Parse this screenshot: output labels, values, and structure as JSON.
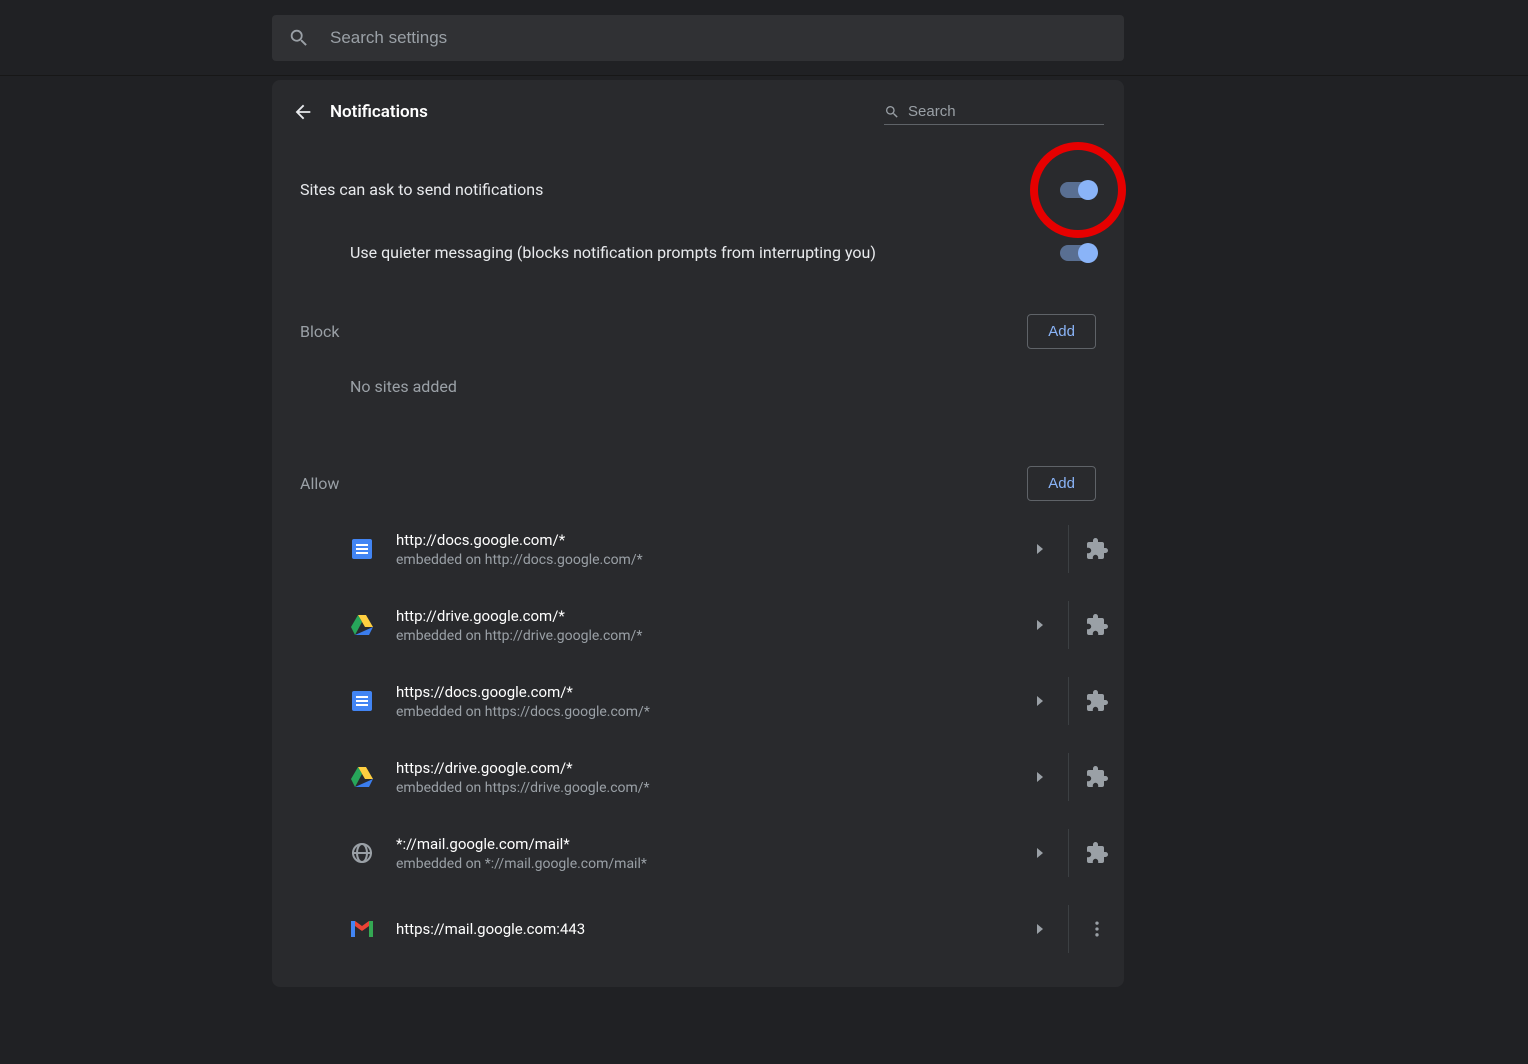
{
  "global_search": {
    "placeholder": "Search settings"
  },
  "page": {
    "title": "Notifications",
    "search_placeholder": "Search"
  },
  "toggles": {
    "ask": {
      "label": "Sites can ask to send notifications",
      "on": true,
      "highlighted": true
    },
    "quiet": {
      "label": "Use quieter messaging (blocks notification prompts from interrupting you)",
      "on": true
    }
  },
  "sections": {
    "block": {
      "label": "Block",
      "add": "Add",
      "empty": "No sites added"
    },
    "allow": {
      "label": "Allow",
      "add": "Add"
    }
  },
  "allow_list": [
    {
      "icon": "docs",
      "url": "http://docs.google.com/*",
      "sub": "embedded on http://docs.google.com/*",
      "action": "puzzle"
    },
    {
      "icon": "drive",
      "url": "http://drive.google.com/*",
      "sub": "embedded on http://drive.google.com/*",
      "action": "puzzle"
    },
    {
      "icon": "docs",
      "url": "https://docs.google.com/*",
      "sub": "embedded on https://docs.google.com/*",
      "action": "puzzle"
    },
    {
      "icon": "drive",
      "url": "https://drive.google.com/*",
      "sub": "embedded on https://drive.google.com/*",
      "action": "puzzle"
    },
    {
      "icon": "globe",
      "url": "*://mail.google.com/mail*",
      "sub": "embedded on *://mail.google.com/mail*",
      "action": "puzzle"
    },
    {
      "icon": "gmail",
      "url": "https://mail.google.com:443",
      "sub": "",
      "action": "dots"
    }
  ]
}
